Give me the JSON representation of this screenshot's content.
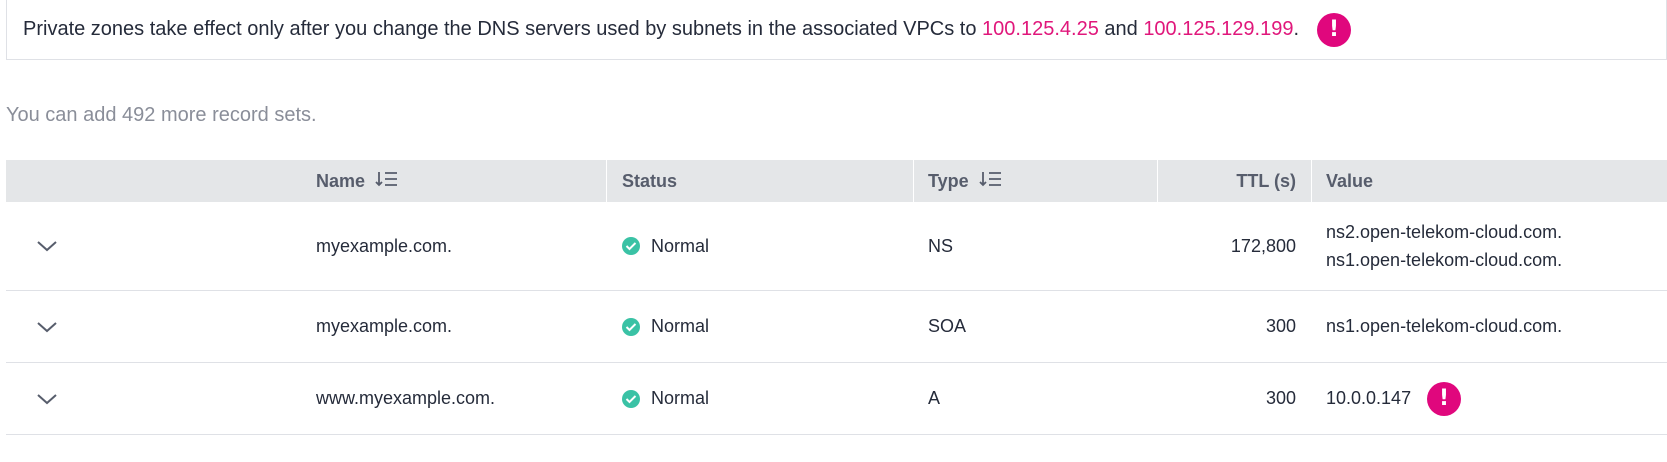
{
  "notice": {
    "text_before": "Private zones take effect only after you change the DNS servers used by subnets in the associated VPCs to ",
    "dns_1": "100.125.4.25",
    "text_middle": " and ",
    "dns_2": "100.125.129.199",
    "text_after": ".",
    "badge": "!"
  },
  "quota_text": "You can add 492 more record sets.",
  "table": {
    "headers": {
      "name": "Name",
      "status": "Status",
      "type": "Type",
      "ttl": "TTL (s)",
      "value": "Value"
    },
    "rows": [
      {
        "name": "myexample.com.",
        "status": "Normal",
        "type": "NS",
        "ttl": "172,800",
        "values": [
          "ns2.open-telekom-cloud.com.",
          "ns1.open-telekom-cloud.com."
        ]
      },
      {
        "name": "myexample.com.",
        "status": "Normal",
        "type": "SOA",
        "ttl": "300",
        "values": [
          "ns1.open-telekom-cloud.com."
        ]
      },
      {
        "name": "www.myexample.com.",
        "status": "Normal",
        "type": "A",
        "ttl": "300",
        "values": [
          "10.0.0.147"
        ],
        "badge": "!"
      }
    ]
  },
  "colors": {
    "accent": "#e0177b",
    "status_normal": "#3ac2a5",
    "header_bg": "#e4e6e8"
  }
}
